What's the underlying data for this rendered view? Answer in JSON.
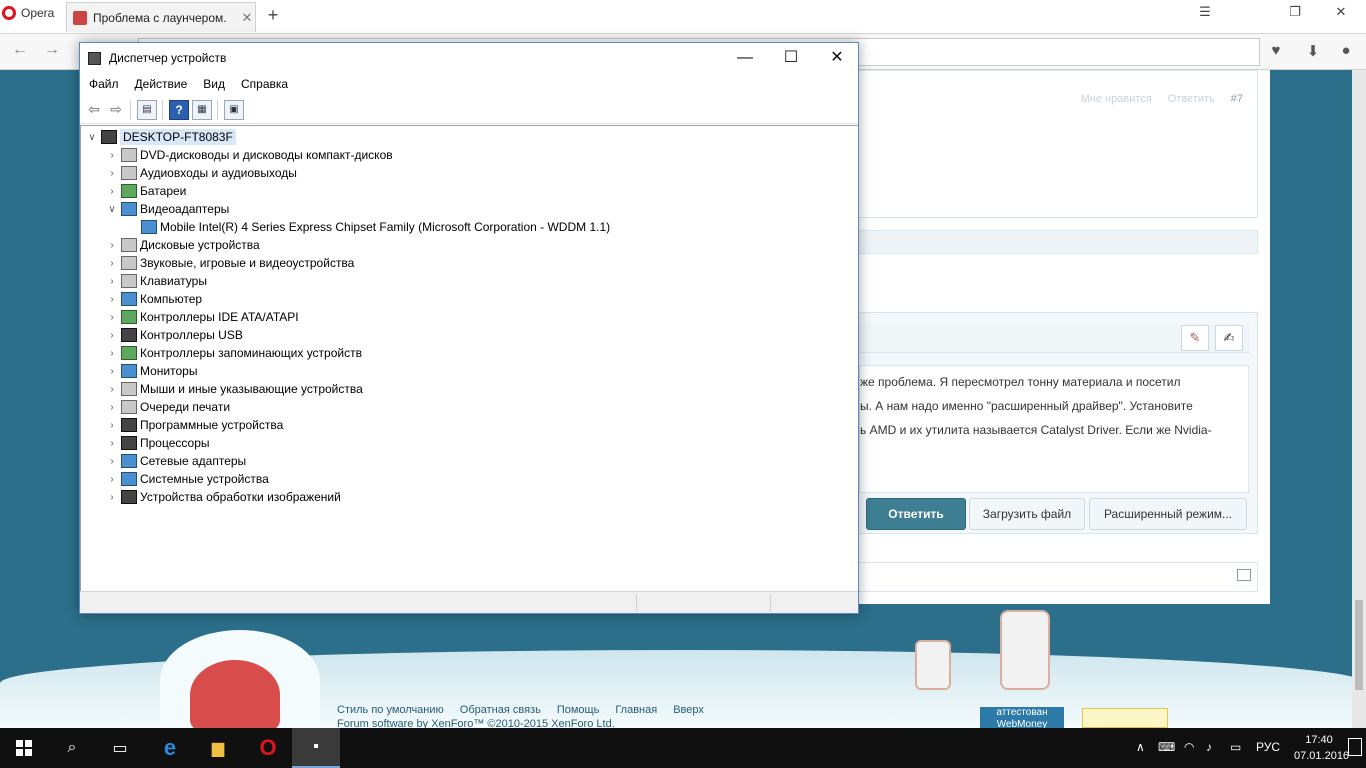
{
  "browser": {
    "menu_label": "Opera",
    "tab_title": "Проблема с лаунчером.",
    "tab_close": "✕",
    "new_tab": "+"
  },
  "webpage": {
    "post_meta": {
      "like": "Мне нравится",
      "reply": "Ответить",
      "post_number": "#7"
    },
    "editor_lines": [
      "же проблема. Я пересмотрел тонну материала и посетил",
      "ы. А нам надо именно \"расширенный драйвер\". Установите",
      "ь AMD и их утилита называется Catalyst Driver. Если же Nvidia-"
    ],
    "buttons": {
      "reply": "Ответить",
      "upload": "Загрузить файл",
      "advanced": "Расширенный режим..."
    },
    "footer_links": [
      "Стиль по умолчанию",
      "Обратная связь",
      "Помощь",
      "Главная",
      "Вверх"
    ],
    "footer_copy": "Forum software by XenForo™ ©2010-2015 XenForo Ltd.",
    "badge": "аттестован\nWebMoney"
  },
  "device_manager": {
    "title": "Диспетчер устройств",
    "menu": [
      "Файл",
      "Действие",
      "Вид",
      "Справка"
    ],
    "root": "DESKTOP-FT8083F",
    "categories": [
      {
        "label": "DVD-дисководы и дисководы компакт-дисков",
        "icon": "dvd-drive-icon",
        "expanded": false
      },
      {
        "label": "Аудиовходы и аудиовыходы",
        "icon": "speaker-icon",
        "expanded": false
      },
      {
        "label": "Батареи",
        "icon": "battery-icon",
        "expanded": false
      },
      {
        "label": "Видеоадаптеры",
        "icon": "display-adapter-icon",
        "expanded": true,
        "children": [
          "Mobile Intel(R) 4 Series Express Chipset Family (Microsoft Corporation - WDDM 1.1)"
        ]
      },
      {
        "label": "Дисковые устройства",
        "icon": "disk-drive-icon",
        "expanded": false
      },
      {
        "label": "Звуковые, игровые и видеоустройства",
        "icon": "sound-device-icon",
        "expanded": false
      },
      {
        "label": "Клавиатуры",
        "icon": "keyboard-icon",
        "expanded": false
      },
      {
        "label": "Компьютер",
        "icon": "computer-icon",
        "expanded": false
      },
      {
        "label": "Контроллеры IDE ATA/ATAPI",
        "icon": "ide-controller-icon",
        "expanded": false
      },
      {
        "label": "Контроллеры USB",
        "icon": "usb-icon",
        "expanded": false
      },
      {
        "label": "Контроллеры запоминающих устройств",
        "icon": "storage-controller-icon",
        "expanded": false
      },
      {
        "label": "Мониторы",
        "icon": "monitor-icon",
        "expanded": false
      },
      {
        "label": "Мыши и иные указывающие устройства",
        "icon": "mouse-icon",
        "expanded": false
      },
      {
        "label": "Очереди печати",
        "icon": "printer-icon",
        "expanded": false
      },
      {
        "label": "Программные устройства",
        "icon": "software-device-icon",
        "expanded": false
      },
      {
        "label": "Процессоры",
        "icon": "processor-icon",
        "expanded": false
      },
      {
        "label": "Сетевые адаптеры",
        "icon": "network-adapter-icon",
        "expanded": false
      },
      {
        "label": "Системные устройства",
        "icon": "system-device-icon",
        "expanded": false
      },
      {
        "label": "Устройства обработки изображений",
        "icon": "imaging-device-icon",
        "expanded": false
      }
    ]
  },
  "taskbar": {
    "language": "РУС",
    "time": "17:40",
    "date": "07.01.2016"
  },
  "colors": {
    "page_bg": "#2b6f8a",
    "reply_button": "#3e7f94",
    "taskbar": "#101010"
  }
}
